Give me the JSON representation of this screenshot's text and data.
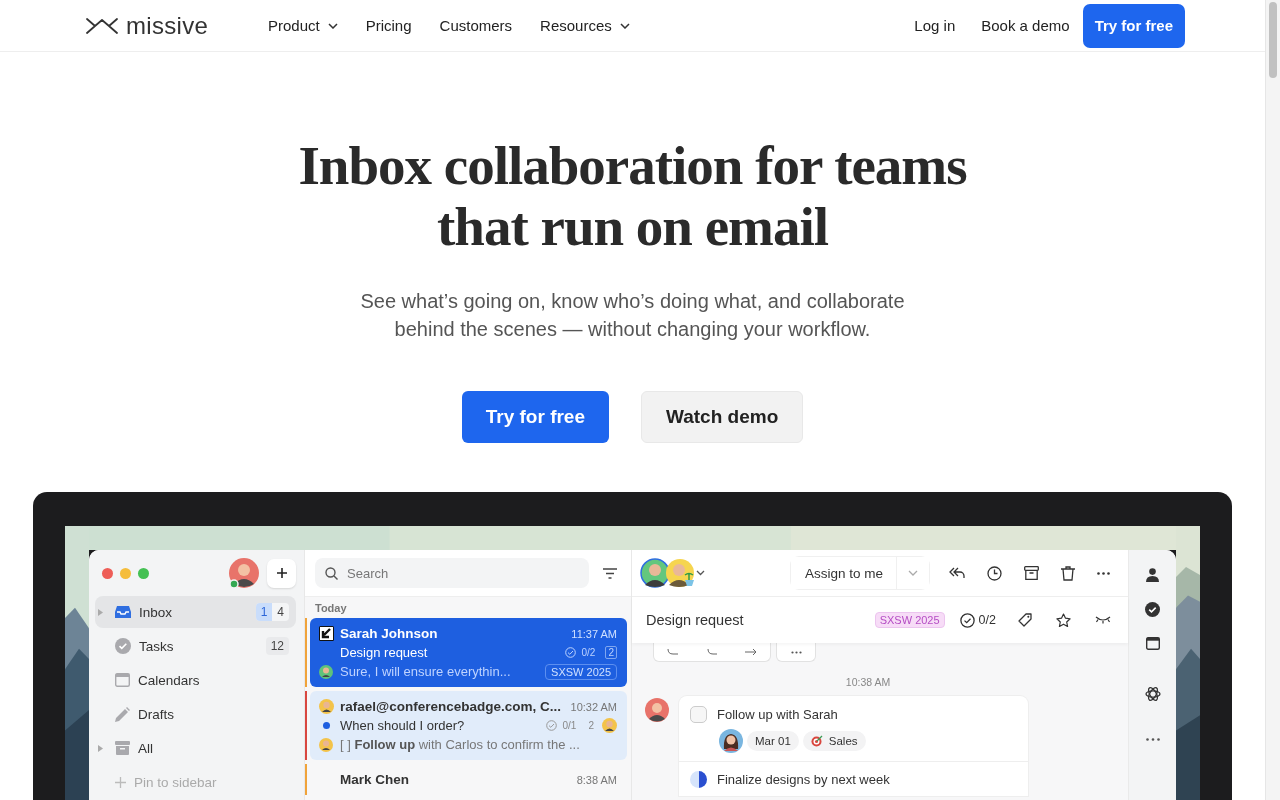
{
  "nav": {
    "logo": "missive",
    "items": [
      {
        "label": "Product",
        "dropdown": true
      },
      {
        "label": "Pricing",
        "dropdown": false
      },
      {
        "label": "Customers",
        "dropdown": false
      },
      {
        "label": "Resources",
        "dropdown": true
      }
    ],
    "links": [
      "Log in",
      "Book a demo"
    ],
    "cta": "Try for free"
  },
  "hero": {
    "title": "Inbox collaboration for teams that run on email",
    "subtitle": "See what’s going on, know who’s doing what, and collaborate behind the scenes — without changing your workflow.",
    "buttons": [
      {
        "label": "Try for free",
        "kind": "primary"
      },
      {
        "label": "Watch demo",
        "kind": "secondary"
      }
    ]
  },
  "app": {
    "sidebar": {
      "items": [
        {
          "label": "Inbox",
          "expandable": true,
          "selected": true,
          "counts": [
            {
              "text": "1",
              "highlight": true
            },
            {
              "text": "4",
              "highlight": false
            }
          ]
        },
        {
          "label": "Tasks",
          "expandable": false,
          "selected": false,
          "counts": [
            {
              "text": "12",
              "highlight": false
            }
          ]
        },
        {
          "label": "Calendars",
          "expandable": false,
          "selected": false
        },
        {
          "label": "Drafts",
          "expandable": false,
          "selected": false
        },
        {
          "label": "All",
          "expandable": true,
          "selected": false
        }
      ],
      "pin": "Pin to sidebar"
    },
    "list": {
      "search": {
        "placeholder": "Search"
      },
      "section": "Today",
      "conversations": [
        {
          "from": "Sarah Johnson",
          "time": "11:37 AM",
          "subject": "Design request",
          "tasks": "0/2",
          "count": "2",
          "preview": "Sure, I will ensure everythin...",
          "tag": "SXSW 2025",
          "selected": true,
          "unread": false,
          "color": "#f0a33a"
        },
        {
          "from": "rafael@conferencebadge.com, C...",
          "time": "10:32 AM",
          "subject": "When should I order?",
          "tasks": "0/1",
          "count": "2",
          "preview": "[ ] **Follow up** with Carlos to confirm the ...",
          "selected": false,
          "unread": true,
          "color": "#d9473f"
        },
        {
          "from": "Mark Chen",
          "time": "8:38 AM",
          "selected": false,
          "color": "#f0a33a"
        }
      ]
    },
    "conversation": {
      "assign": "Assign to me",
      "subject": "Design request",
      "tag": "SXSW 2025",
      "tasks": "0/2",
      "time": "10:38 AM",
      "items": [
        {
          "kind": "checkbox",
          "label": "Follow up with Sarah",
          "checked": false,
          "date": "Mar 01",
          "label_tag": "Sales"
        },
        {
          "kind": "progress",
          "label": "Finalize designs by next week",
          "level": 0.5
        }
      ]
    }
  }
}
